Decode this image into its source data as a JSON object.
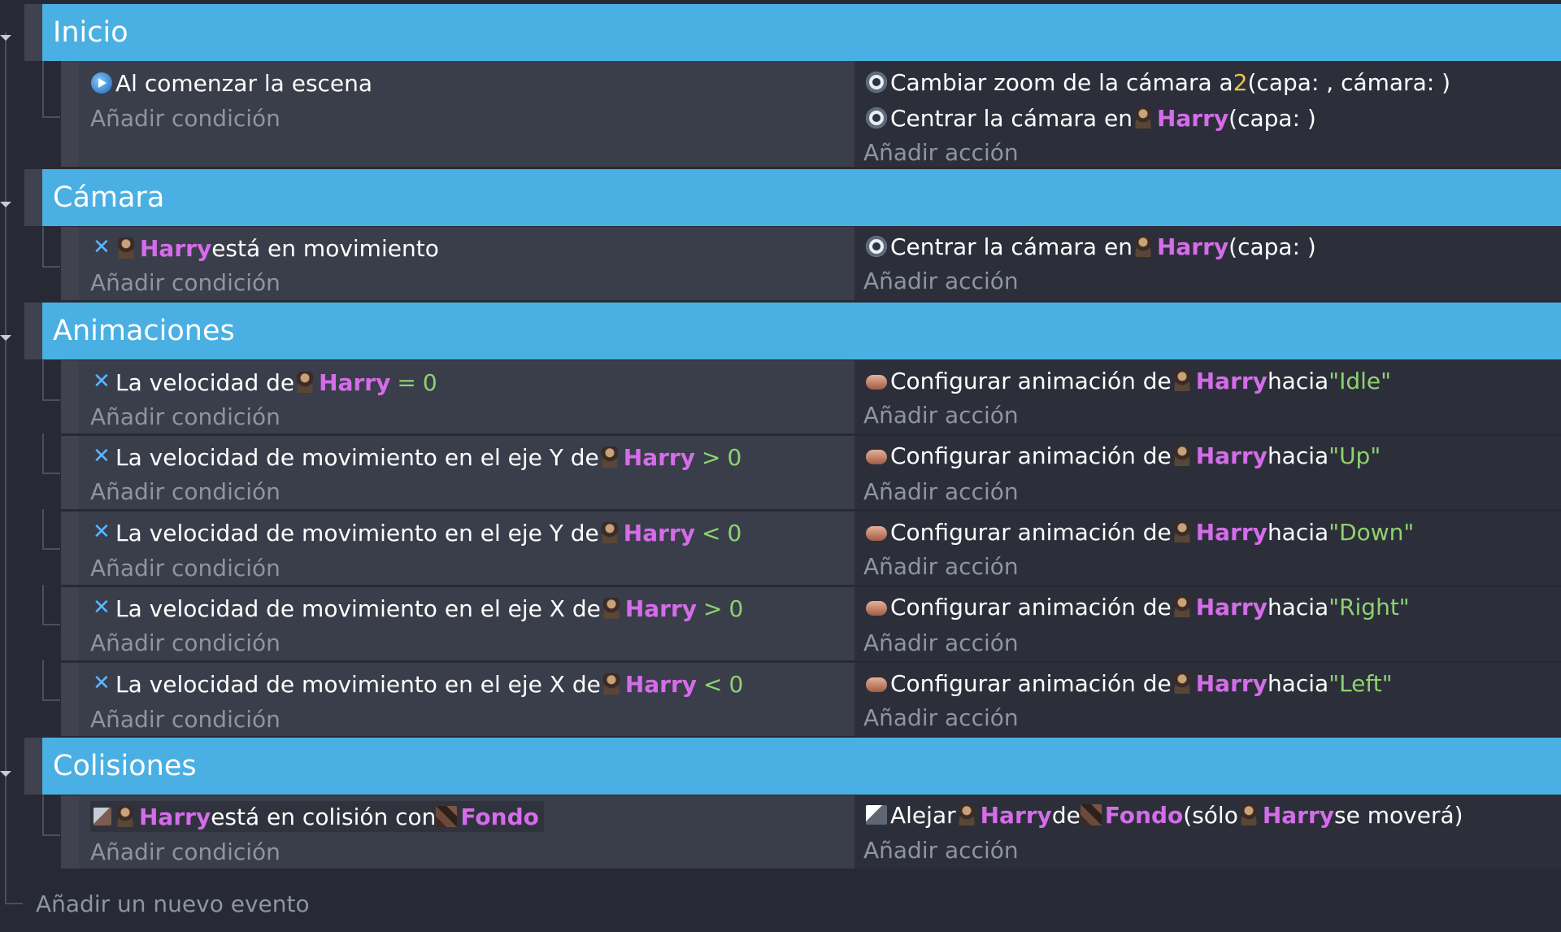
{
  "groups": [
    {
      "title": "Inicio",
      "events": [
        {
          "conditions": [
            {
              "icon": "start-icon",
              "text": "Al comenzar la escena"
            }
          ],
          "add_condition": "Añadir condición",
          "actions": [
            {
              "icon": "camera-icon",
              "pre": "Cambiar zoom de la cámara a ",
              "num": "2",
              "post": " (capa: , cámara: )"
            },
            {
              "icon": "camera-icon",
              "pre": "Centrar la cámara en ",
              "obj": "Harry",
              "post": " (capa: )"
            }
          ],
          "add_action": "Añadir acción"
        }
      ]
    },
    {
      "title": "Cámara",
      "events": [
        {
          "conditions": [
            {
              "icon": "move-icon",
              "obj": "Harry",
              "post": " está en movimiento"
            }
          ],
          "add_condition": "Añadir condición",
          "actions": [
            {
              "icon": "camera-icon",
              "pre": "Centrar la cámara en ",
              "obj": "Harry",
              "post": " (capa: )"
            }
          ],
          "add_action": "Añadir acción"
        }
      ]
    },
    {
      "title": "Animaciones",
      "events": [
        {
          "condition": {
            "pre": "La velocidad de ",
            "obj": "Harry",
            "op": "=",
            "val": "0"
          },
          "add_condition": "Añadir condición",
          "action": {
            "pre": "Configurar animación de ",
            "obj": "Harry",
            "mid": " hacia ",
            "str": "\"Idle\""
          },
          "add_action": "Añadir acción"
        },
        {
          "condition": {
            "pre": "La velocidad de movimiento en el eje Y de ",
            "obj": "Harry",
            "op": ">",
            "val": "0"
          },
          "add_condition": "Añadir condición",
          "action": {
            "pre": "Configurar animación de ",
            "obj": "Harry",
            "mid": " hacia ",
            "str": "\"Up\""
          },
          "add_action": "Añadir acción"
        },
        {
          "condition": {
            "pre": "La velocidad de movimiento en el eje Y de ",
            "obj": "Harry",
            "op": "<",
            "val": "0"
          },
          "add_condition": "Añadir condición",
          "action": {
            "pre": "Configurar animación de ",
            "obj": "Harry",
            "mid": " hacia ",
            "str": "\"Down\""
          },
          "add_action": "Añadir acción"
        },
        {
          "condition": {
            "pre": "La velocidad de movimiento en el eje X de ",
            "obj": "Harry",
            "op": ">",
            "val": "0"
          },
          "add_condition": "Añadir condición",
          "action": {
            "pre": "Configurar animación de ",
            "obj": "Harry",
            "mid": " hacia ",
            "str": "\"Right\""
          },
          "add_action": "Añadir acción"
        },
        {
          "condition": {
            "pre": "La velocidad de movimiento en el eje X de ",
            "obj": "Harry",
            "op": "<",
            "val": "0"
          },
          "add_condition": "Añadir condición",
          "action": {
            "pre": "Configurar animación de ",
            "obj": "Harry",
            "mid": " hacia ",
            "str": "\"Left\""
          },
          "add_action": "Añadir acción"
        }
      ]
    },
    {
      "title": "Colisiones",
      "events": [
        {
          "condition": {
            "obj1": "Harry",
            "mid": " está en colisión con ",
            "obj2": "Fondo"
          },
          "add_condition": "Añadir condición",
          "action": {
            "pre": "Alejar ",
            "obj1": "Harry",
            "mid1": " de ",
            "obj2": "Fondo",
            "mid2": " (sólo ",
            "obj3": "Harry",
            "post": " se moverá)"
          },
          "add_action": "Añadir acción"
        }
      ]
    }
  ],
  "footer": {
    "add_event": "Añadir un nuevo evento"
  },
  "colors": {
    "group_bar": "#4ab0e3",
    "background": "#272a35",
    "condition_bg": "#3a3e4b",
    "object_name": "#d56ce9",
    "number": "#e8c64a",
    "string": "#8fd170",
    "muted": "#8f94a1"
  }
}
